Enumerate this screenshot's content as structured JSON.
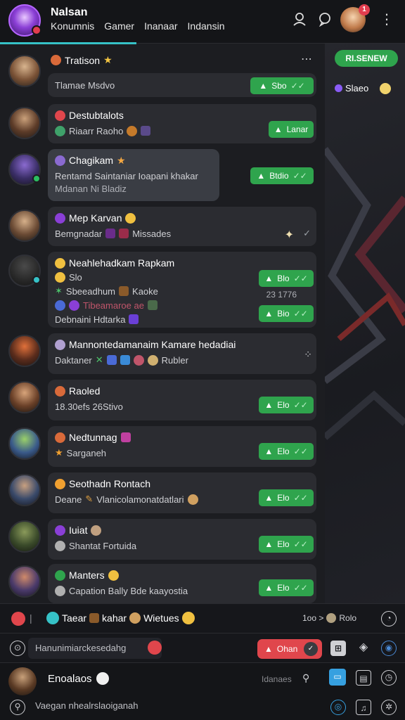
{
  "header": {
    "title": "Nalsan",
    "tabs": [
      "Konumnis",
      "Gamer",
      "Inanaar",
      "Indansin"
    ],
    "notification_count": "1"
  },
  "right_panel": {
    "button_label": "RI.SENEW",
    "stat_label": "Slaeo"
  },
  "top_row": {
    "name": "Tratison",
    "menu_icon": "more-icon"
  },
  "chats": [
    {
      "msg": "Tlamae Msdvo",
      "status": "Sbo"
    },
    {
      "name": "Destubtalots",
      "msg": "Riaarr Raoho",
      "status": "Lanar"
    },
    {
      "name": "Chagikam",
      "msg": "Rentamd Saintaniar Ioapani khakar",
      "msg2": "Mdanan Ni Bladiz",
      "status": "Btdio"
    },
    {
      "name": "Mep Karvan",
      "msg": "Bemgnadar",
      "msg_tail": "Missades"
    },
    {
      "name": "Neahlehadkam Rapkam",
      "msg": "Slo",
      "msg2": "Sbeeadhum",
      "msg2_tail": "Kaoke",
      "msg3": "Tibeamaroe ae",
      "msg4": "Debnaini Hdtarka",
      "status": "Blo",
      "time": "23 1776",
      "status2": "Bio"
    },
    {
      "name": "Mannontedamanaim Kamare hedadiai",
      "msg": "Daktaner",
      "msg_tail": "Rubler"
    },
    {
      "name": "Raoled",
      "msg": "18.30efs 26Stivo",
      "status": "Elo"
    },
    {
      "name": "Nedtunnag",
      "msg": "Sarganeh",
      "status": "Elo"
    },
    {
      "name": "Seothadn Rontach",
      "msg": "Deane",
      "msg_tail": "Vlanicolamonatdatlari",
      "status": "Elo"
    },
    {
      "name": "Iuiat",
      "msg": "Shantat Fortuida",
      "status": "Elo"
    },
    {
      "name": "Manters",
      "msg": "Capation Bally Bde kaayostia",
      "status": "Elo"
    }
  ],
  "status_bar": {
    "label": "Taear",
    "label2": "kahar",
    "label3": "Wietues",
    "right_text": "1oo >",
    "right_label": "Rolo"
  },
  "composer": {
    "placeholder": "Hanunimiarckesedahg",
    "send_label": "Ohan"
  },
  "footer": {
    "name": "Enoalaos",
    "sub": "Idanaes",
    "search_placeholder": "Vaegan nhealrslaoiganah"
  },
  "colors": {
    "accent_green": "#2fa44d",
    "accent_red": "#e0464c",
    "accent_teal": "#36c2c7"
  }
}
